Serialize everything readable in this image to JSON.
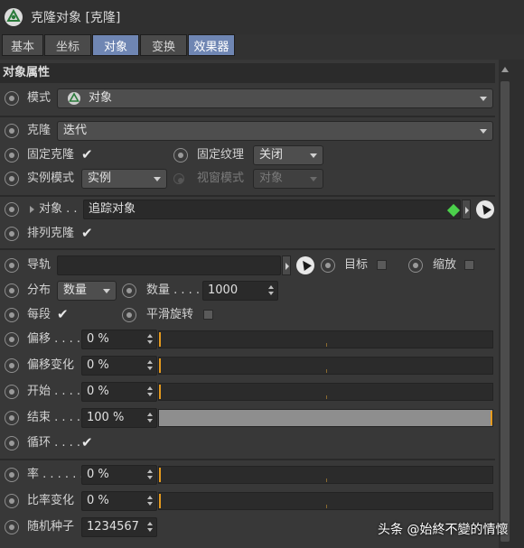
{
  "window": {
    "title": "克隆对象 [克隆]"
  },
  "tabs": [
    {
      "label": "基本",
      "active": false
    },
    {
      "label": "坐标",
      "active": false
    },
    {
      "label": "对象",
      "active": true
    },
    {
      "label": "变换",
      "active": false
    },
    {
      "label": "效果器",
      "active": true
    }
  ],
  "section": {
    "title": "对象属性"
  },
  "fields": {
    "mode": {
      "label": "模式",
      "value": "对象",
      "icon": "cloner-icon"
    },
    "clone": {
      "label": "克隆",
      "value": "迭代"
    },
    "fix_clone": {
      "label": "固定克隆",
      "checked": true
    },
    "fix_texture": {
      "label": "固定纹理",
      "value": "关闭"
    },
    "instance_mode": {
      "label": "实例模式",
      "value": "实例"
    },
    "viewport_mode": {
      "label": "视窗模式",
      "value": "对象"
    },
    "object": {
      "label": "对象 . .",
      "value": "追踪对象"
    },
    "arrange_clones": {
      "label": "排列克隆",
      "checked": true
    },
    "rail": {
      "label": "导轨",
      "value": ""
    },
    "target": {
      "label": "目标",
      "checked": false
    },
    "scale": {
      "label": "缩放",
      "checked": false
    },
    "distribution": {
      "label": "分布",
      "value": "数量"
    },
    "count": {
      "label": "数量 . . . .",
      "value": "1000"
    },
    "per_segment": {
      "label": "每段",
      "checked": true
    },
    "smooth_rotation": {
      "label": "平滑旋转",
      "checked": false
    },
    "offset": {
      "label": "偏移 . . . .",
      "value": "0 %",
      "fraction": 0
    },
    "offset_variation": {
      "label": "偏移变化",
      "value": "0 %",
      "fraction": 0
    },
    "start": {
      "label": "开始 . . . .",
      "value": "0 %",
      "fraction": 0
    },
    "end": {
      "label": "结束 . . . .",
      "value": "100 %",
      "fraction": 1
    },
    "loop": {
      "label": "循环 . . . .",
      "checked": true
    },
    "rate": {
      "label": "率 . . . . . .",
      "value": "0 %",
      "fraction": 0
    },
    "rate_variation": {
      "label": "比率变化",
      "value": "0 %",
      "fraction": 0
    },
    "seed": {
      "label": "随机种子",
      "value": "1234567"
    }
  },
  "watermark": "头条 @始終不變的情懷",
  "colors": {
    "active_tab": "#6f86b3",
    "slider_marker": "#e59a1e",
    "panel": "#383838"
  }
}
